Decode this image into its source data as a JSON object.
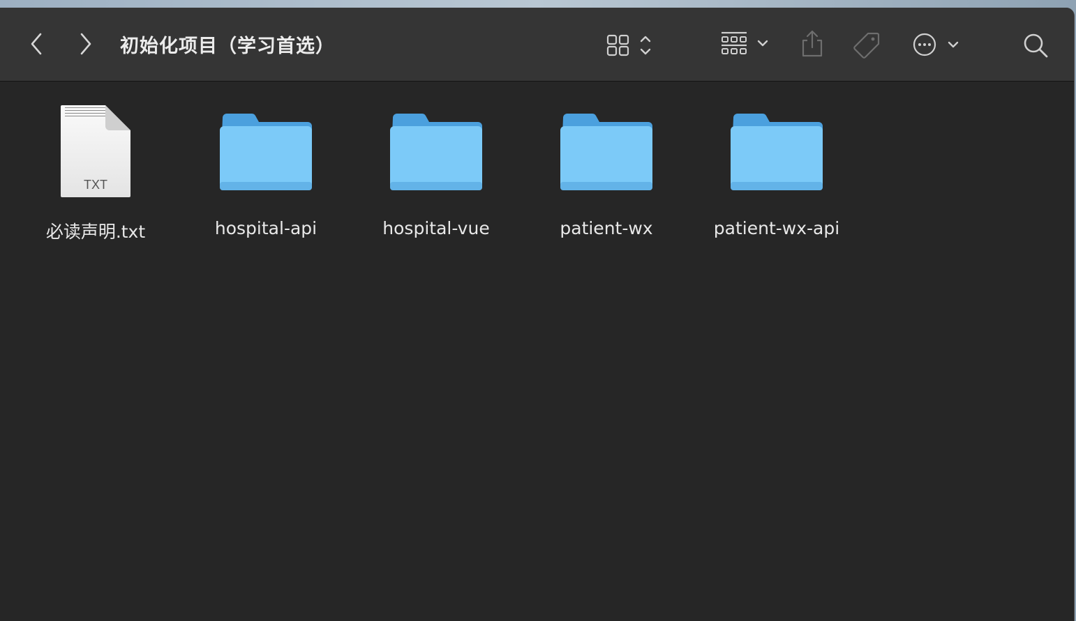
{
  "window": {
    "title": "初始化项目（学习首选）"
  },
  "toolbar": {
    "back_icon": "chevron-left-icon",
    "forward_icon": "chevron-right-icon",
    "view_icon": "icon-grid-view-icon",
    "group_icon": "group-by-icon",
    "share_icon": "share-icon",
    "tag_icon": "tag-icon",
    "more_icon": "ellipsis-circle-icon",
    "search_icon": "search-icon"
  },
  "files": [
    {
      "name": "必读声明.txt",
      "kind": "text-document",
      "badge": "TXT"
    },
    {
      "name": "hospital-api",
      "kind": "folder"
    },
    {
      "name": "hospital-vue",
      "kind": "folder"
    },
    {
      "name": "patient-wx",
      "kind": "folder"
    },
    {
      "name": "patient-wx-api",
      "kind": "folder"
    }
  ],
  "colors": {
    "window_bg": "#262626",
    "toolbar_bg": "#353535",
    "folder_blue": "#6ebcf2",
    "text": "#e8e8e8"
  }
}
